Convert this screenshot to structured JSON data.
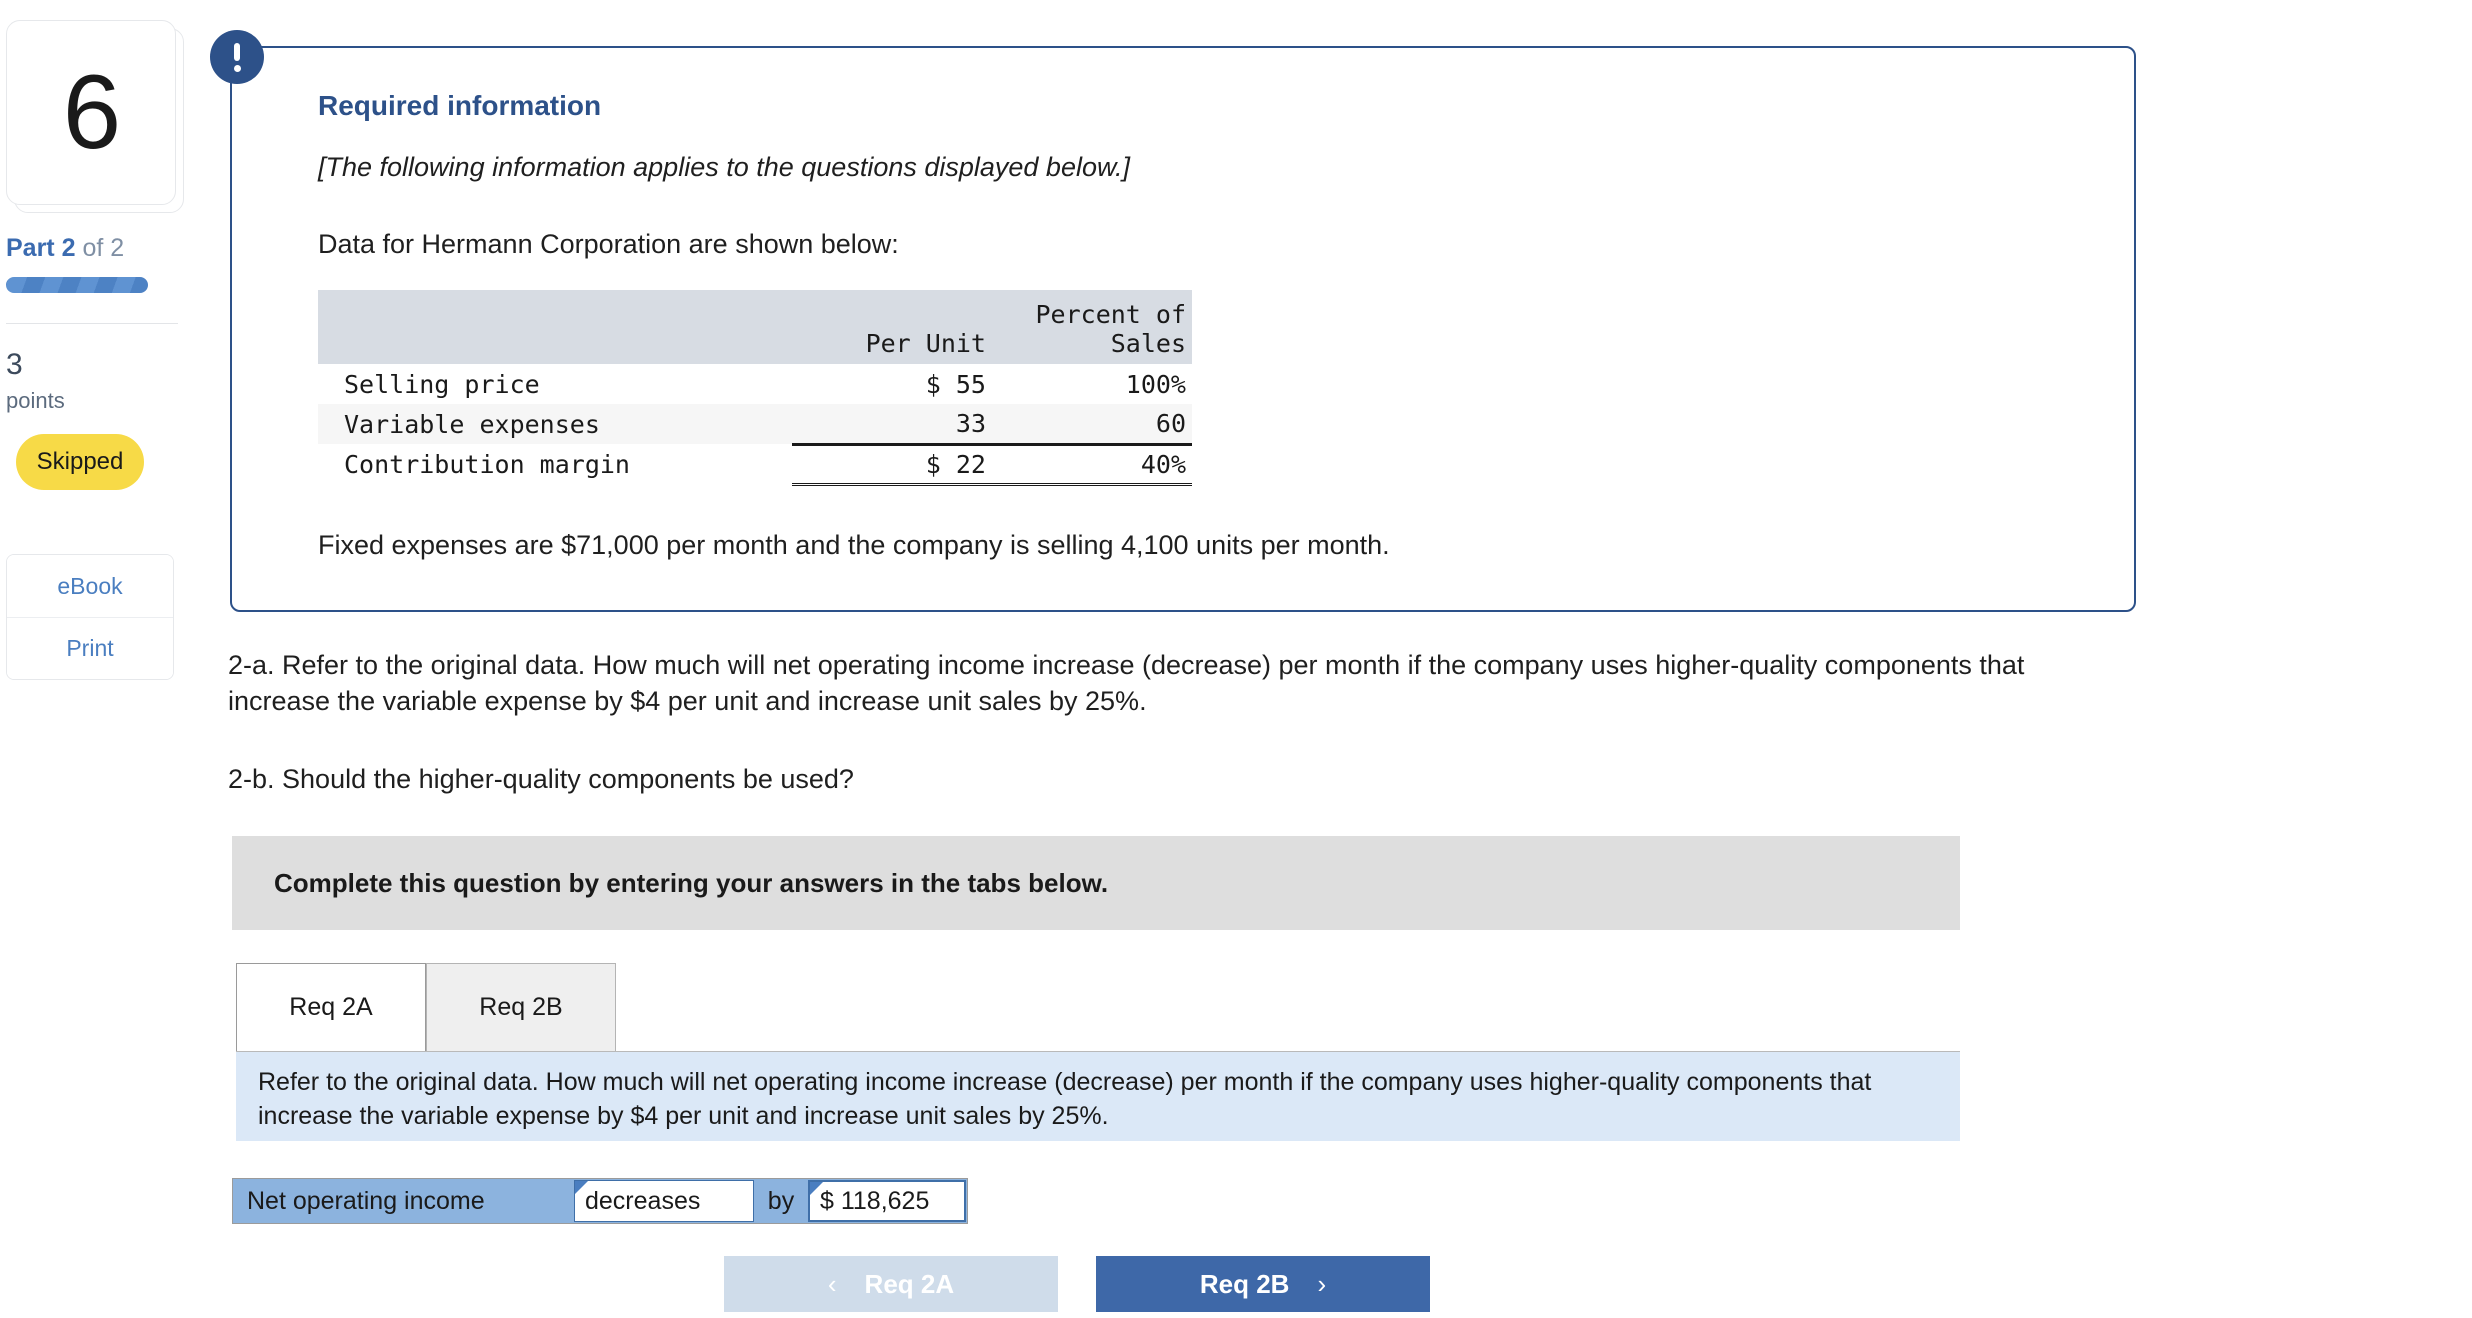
{
  "sidebar": {
    "question_number": "6",
    "part_label_prefix": "Part ",
    "part_current": "2",
    "part_suffix": " of 2",
    "points_value": "3",
    "points_word": "points",
    "status_badge": "Skipped",
    "tools": [
      {
        "label": "eBook"
      },
      {
        "label": "Print"
      }
    ]
  },
  "info_panel": {
    "icon": "exclamation-icon",
    "title": "Required information",
    "italic_note": "[The following information applies to the questions displayed below.]",
    "intro": "Data for Hermann Corporation are shown below:",
    "footnote": "Fixed expenses are $71,000 per month and the company is selling 4,100 units per month.",
    "table": {
      "headers": [
        "",
        "Per Unit",
        "Percent of Sales"
      ],
      "header_line1": [
        "",
        "",
        "Percent of"
      ],
      "header_line2": [
        "",
        "Per Unit",
        "Sales"
      ],
      "rows": [
        {
          "label": "Selling price",
          "per_unit": "$ 55",
          "percent": "100%"
        },
        {
          "label": "Variable expenses",
          "per_unit": "33",
          "percent": "60"
        },
        {
          "label": "Contribution margin",
          "per_unit": "$ 22",
          "percent": "40%"
        }
      ]
    }
  },
  "questions": {
    "q2a": "2-a. Refer to the original data. How much will net operating income increase (decrease) per month if the company uses higher-quality components that increase the variable expense by $4 per unit and increase unit sales by 25%.",
    "q2b": "2-b. Should the higher-quality components be used?"
  },
  "banner": {
    "text": "Complete this question by entering your answers in the tabs below."
  },
  "tabs": [
    {
      "label": "Req 2A",
      "active": true
    },
    {
      "label": "Req 2B",
      "active": false
    }
  ],
  "instruction": {
    "text": "Refer to the original data. How much will net operating income increase (decrease) per month if the company uses higher-quality components that increase the variable expense by $4 per unit and increase unit sales by 25%."
  },
  "answer_row": {
    "label": "Net operating income",
    "direction_value": "decreases",
    "connector": "by",
    "amount_value": "$ 118,625"
  },
  "nav": {
    "prev_label": "Req 2A",
    "prev_chevron": "‹",
    "next_label": "Req 2B",
    "next_chevron": "›"
  },
  "colors": {
    "accent_navy": "#2d5189",
    "accent_blue": "#3e68a8",
    "cell_blue": "#8cb3de",
    "badge_yellow": "#f7da47",
    "banner_gray": "#dedede",
    "instruction_blue": "#dbe8f7",
    "table_header": "#d7dce3"
  }
}
